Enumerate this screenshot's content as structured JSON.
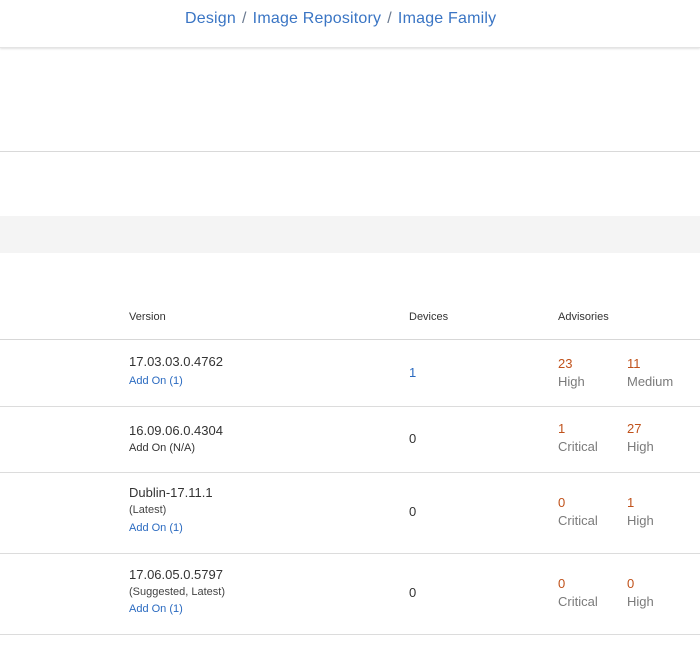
{
  "breadcrumb": {
    "items": [
      "Design",
      "Image Repository",
      "Image Family"
    ],
    "separator": "/"
  },
  "table": {
    "columns": {
      "version": "Version",
      "devices": "Devices",
      "advisories": "Advisories"
    },
    "rows": [
      {
        "version": "17.03.03.0.4762",
        "tag": "",
        "addon": "Add On (1)",
        "addon_is_link": true,
        "devices": "1",
        "devices_is_link": true,
        "adv1_count": "23",
        "adv1_label": "High",
        "adv2_count": "11",
        "adv2_label": "Medium"
      },
      {
        "version": "16.09.06.0.4304",
        "tag": "",
        "addon": "Add On (N/A)",
        "addon_is_link": false,
        "devices": "0",
        "devices_is_link": false,
        "adv1_count": "1",
        "adv1_label": "Critical",
        "adv2_count": "27",
        "adv2_label": "High"
      },
      {
        "version": "Dublin-17.11.1",
        "tag": "(Latest)",
        "addon": "Add On (1)",
        "addon_is_link": true,
        "devices": "0",
        "devices_is_link": false,
        "adv1_count": "0",
        "adv1_label": "Critical",
        "adv2_count": "1",
        "adv2_label": "High"
      },
      {
        "version": "17.06.05.0.5797",
        "tag": "(Suggested, Latest)",
        "addon": "Add On (1)",
        "addon_is_link": true,
        "devices": "0",
        "devices_is_link": false,
        "adv1_count": "0",
        "adv1_label": "Critical",
        "adv2_count": "0",
        "adv2_label": "High"
      }
    ]
  },
  "colors": {
    "link": "#2a6ac0",
    "advisory_count": "#c0521b",
    "advisory_label": "#7a7a7a",
    "band": "#f4f4f4"
  }
}
